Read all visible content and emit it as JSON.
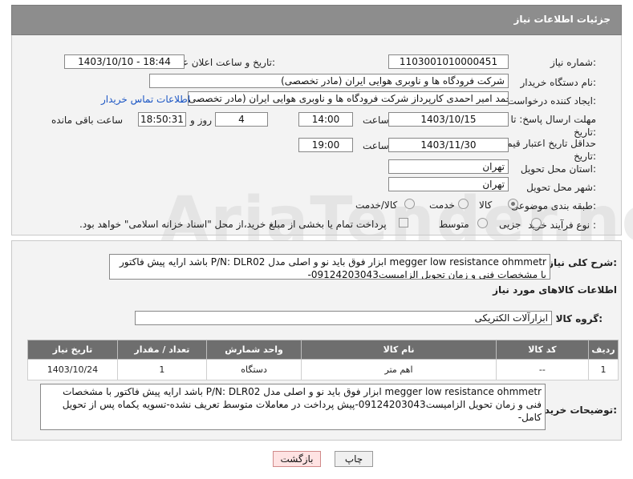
{
  "header": {
    "title": "جزئیات اطلاعات نیاز"
  },
  "fields": {
    "need_number_label": "شماره نیاز:",
    "need_number": "1103001010000451",
    "announce_label": "تاریخ و ساعت اعلان عمومی:",
    "announce_value": "1403/10/10 - 18:44",
    "buyer_org_label": "نام دستگاه خریدار:",
    "buyer_org": "شرکت فرودگاه ها و ناوبری هوایی ایران (مادر تخصصی)",
    "requester_label": "ایجاد کننده درخواست:",
    "requester": "محمد امیر احمدی کارپرداز شرکت فرودگاه ها و ناوبری هوایی ایران (مادر تخصصی",
    "buyer_contact_link": "اطلاعات تماس خریدار",
    "deadline_label": "مهلت ارسال پاسخ: تا تاریخ:",
    "deadline_date": "1403/10/15",
    "time_label": "ساعت",
    "deadline_time": "14:00",
    "days_value": "4",
    "days_label": "روز و",
    "remaining_time": "18:50:31",
    "remaining_label": "ساعت باقی مانده",
    "validity_label": "حداقل تاریخ اعتبار قیمت: تا تاریخ:",
    "validity_date": "1403/11/30",
    "validity_time": "19:00",
    "province_label": "استان محل تحویل:",
    "province": "تهران",
    "city_label": "شهر محل تحویل:",
    "city": "تهران",
    "category_label": "طبقه بندی موضوعی:",
    "category_options": [
      "کالا",
      "خدمت",
      "کالا/خدمت"
    ],
    "process_label": "نوع فرآیند خرید :",
    "process_options": [
      "جزیی",
      "متوسط"
    ],
    "payment_note": "پرداخت تمام یا بخشی از مبلغ خرید،از محل \"اسناد خزانه اسلامی\" خواهد بود."
  },
  "description": {
    "label": "شرح کلی نیاز:",
    "text": "megger low resistance ohmmetr ابزار فوق باید نو و اصلی مدل P/N: DLR02 باشد ارایه پیش فاکتور با مشخصات فنی و زمان تحویل الزامیست09124203043-"
  },
  "goods_section": {
    "title": "اطلاعات کالاهای مورد نیاز",
    "group_label": "گروه کالا:",
    "group_value": "ابزارآلات الکتریکی"
  },
  "table": {
    "headers": [
      "ردیف",
      "کد کالا",
      "نام کالا",
      "واحد شمارش",
      "تعداد / مقدار",
      "تاریخ نیاز"
    ],
    "rows": [
      [
        "1",
        "--",
        "اهم متر",
        "دستگاه",
        "1",
        "1403/10/24"
      ]
    ]
  },
  "buyer_notes": {
    "label": "توضیحات خریدار:",
    "text": "megger low resistance ohmmetr ابزار فوق باید نو و اصلی مدل P/N: DLR02 باشد ارایه پیش فاکتور با مشخصات فنی و زمان تحویل الزامیست09124203043-پیش پرداخت در معاملات متوسط تعریف نشده-تسویه یکماه پس از تحویل کامل-"
  },
  "buttons": {
    "print": "چاپ",
    "back": "بازگشت"
  },
  "watermark": "AriaTender.neT"
}
